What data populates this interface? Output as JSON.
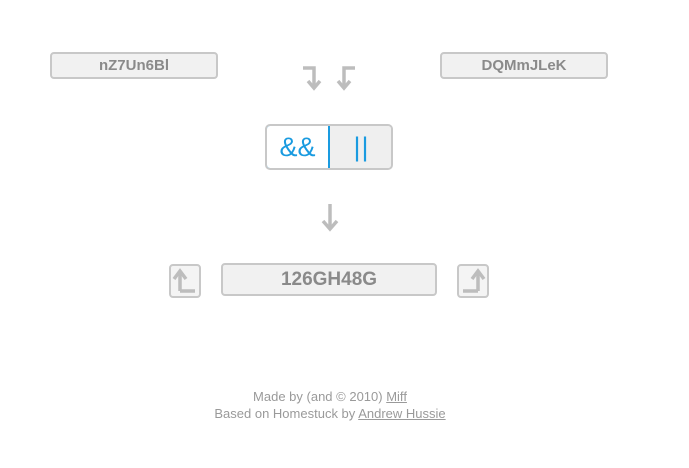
{
  "inputs": {
    "left_code": "nZ7Un6Bl",
    "right_code": "DQMmJLeK"
  },
  "operators": {
    "and_label": "&&",
    "or_label": "||",
    "selected": "and"
  },
  "result": {
    "code": "126GH48G"
  },
  "footer": {
    "line1_prefix": "Made by (and © 2010)",
    "line1_link": "Miff",
    "line2_prefix": "Based on Homestuck by",
    "line2_link": "Andrew Hussie"
  },
  "colors": {
    "accent": "#1a9be0",
    "box_border": "#c8c8c8",
    "box_fill": "#f1f1f1",
    "text_gray": "#8a8a8a"
  },
  "icons": {
    "left_down": "down-right-corner-arrow-icon",
    "right_down": "down-left-corner-arrow-icon",
    "center_down": "down-arrow-icon",
    "side_left": "up-corner-arrow-icon",
    "side_right": "up-corner-arrow-icon"
  }
}
